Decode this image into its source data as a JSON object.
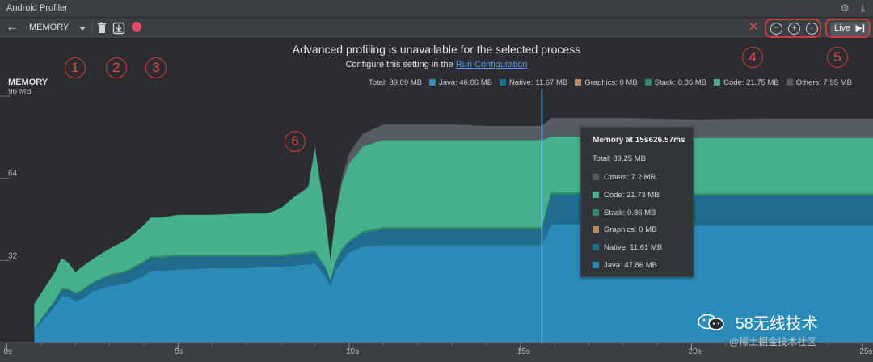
{
  "window": {
    "title": "Android Profiler"
  },
  "toolbar": {
    "profiler_select": "MEMORY",
    "live_label": "Live"
  },
  "banner": {
    "message": "Advanced profiling is unavailable for the selected process",
    "sub_prefix": "Configure this setting in the",
    "sub_link": "Run Configuration"
  },
  "callouts": [
    "1",
    "2",
    "3",
    "4",
    "5",
    "6"
  ],
  "stage": {
    "label": "MEMORY"
  },
  "legend": [
    {
      "text": "Total: 89.09 MB",
      "color": ""
    },
    {
      "text": "Java: 46.86 MB",
      "color": "#2a8ab8"
    },
    {
      "text": "Native: 11.67 MB",
      "color": "#1f6c8f"
    },
    {
      "text": "Graphics: 0 MB",
      "color": "#b58b6b"
    },
    {
      "text": "Stack: 0.86 MB",
      "color": "#2f8a6b"
    },
    {
      "text": "Code: 21.75 MB",
      "color": "#45b08c"
    },
    {
      "text": "Others: 7.95 MB",
      "color": "#565c63"
    }
  ],
  "tooltip": {
    "title": "Memory at 15s626.57ms",
    "total": "Total: 89.25 MB",
    "rows": [
      {
        "text": "Others: 7.2 MB",
        "color": "#565c63"
      },
      {
        "text": "Code: 21.73 MB",
        "color": "#45b08c"
      },
      {
        "text": "Stack: 0.86 MB",
        "color": "#2f8a6b"
      },
      {
        "text": "Graphics: 0 MB",
        "color": "#b58b6b"
      },
      {
        "text": "Native: 11.61 MB",
        "color": "#1f6c8f"
      },
      {
        "text": "Java: 47.86 MB",
        "color": "#2a8ab8"
      }
    ]
  },
  "watermark": {
    "text": "58无线技术",
    "sub": "@稀土掘金技术社区"
  },
  "chart_data": {
    "type": "area",
    "stacked": true,
    "y_ticks": [
      {
        "value": 96,
        "label": "96 MB"
      },
      {
        "value": 64,
        "label": "64"
      },
      {
        "value": 32,
        "label": "32"
      }
    ],
    "ylim": [
      0,
      96
    ],
    "x_ticks": [
      {
        "value": 0,
        "label": "0s"
      },
      {
        "value": 5,
        "label": "5s"
      },
      {
        "value": 10,
        "label": "10s"
      },
      {
        "value": 15,
        "label": "15s"
      },
      {
        "value": 20,
        "label": "20s"
      },
      {
        "value": 25,
        "label": "25s"
      }
    ],
    "xlim": [
      -0.2,
      25.3
    ],
    "cursor_x": 15.63,
    "x": [
      0.8,
      1.0,
      1.4,
      1.6,
      1.8,
      2.0,
      2.2,
      2.5,
      3.0,
      3.5,
      4.0,
      4.2,
      4.5,
      5.0,
      6.0,
      7.0,
      7.6,
      8.0,
      8.4,
      8.8,
      9.0,
      9.3,
      9.45,
      9.6,
      9.8,
      10.0,
      10.4,
      11.0,
      12.0,
      13.0,
      14.0,
      15.0,
      15.63,
      15.9,
      16.5,
      18.0,
      20.0,
      22.0,
      24.0,
      25.3
    ],
    "series": [
      {
        "name": "Java",
        "color": "#2a8ab8",
        "values": [
          5,
          8,
          14,
          18,
          18,
          16,
          17,
          20,
          22,
          23,
          26,
          28,
          28,
          28.5,
          29,
          29,
          29.5,
          29.5,
          30,
          30.5,
          31,
          26,
          22,
          28,
          32,
          35,
          37.5,
          38,
          38,
          38,
          38,
          38,
          38,
          46,
          46,
          46,
          45.5,
          45.5,
          45.5,
          45.5
        ]
      },
      {
        "name": "Native",
        "color": "#1f6c8f",
        "values": [
          0,
          1,
          2,
          2.5,
          2.5,
          3,
          3,
          3,
          4,
          4.5,
          5,
          5,
          5,
          5,
          4.5,
          4.5,
          4,
          4,
          4,
          4,
          4,
          3,
          2,
          3,
          4,
          4,
          5,
          6,
          6,
          6,
          6,
          6,
          6,
          11.7,
          11.7,
          11.7,
          11.7,
          11.7,
          11.7,
          11.7
        ]
      },
      {
        "name": "Stack",
        "color": "#2f8a6b",
        "values": [
          0,
          0.2,
          0.4,
          0.5,
          0.5,
          0.5,
          0.5,
          0.5,
          0.6,
          0.6,
          0.7,
          0.7,
          0.7,
          0.8,
          0.8,
          0.8,
          0.8,
          0.8,
          0.8,
          0.8,
          0.8,
          0.5,
          0.3,
          0.5,
          0.8,
          0.8,
          0.9,
          0.9,
          0.9,
          0.9,
          0.9,
          0.9,
          0.9,
          0.86,
          0.86,
          0.86,
          0.86,
          0.86,
          0.86,
          0.86
        ]
      },
      {
        "name": "Code",
        "color": "#45b08c",
        "values": [
          10,
          10,
          11,
          12,
          10,
          8,
          9,
          9,
          10,
          12,
          14,
          15,
          15,
          15.5,
          15.5,
          16,
          16,
          18,
          22,
          25,
          40,
          20,
          8,
          18,
          26,
          30,
          33,
          34,
          34,
          34,
          34,
          34,
          34,
          21.7,
          21.7,
          21.7,
          21.7,
          21.7,
          21.7,
          21.7
        ]
      },
      {
        "name": "Others",
        "color": "#565c63",
        "values": [
          0,
          0,
          0,
          0,
          0,
          0,
          0,
          0,
          0,
          0,
          0,
          0,
          0,
          0,
          0,
          0,
          0,
          0,
          0,
          0.5,
          1,
          0.5,
          0,
          1,
          2,
          4,
          5,
          6,
          6,
          6,
          5.5,
          5.5,
          5.5,
          7.2,
          7.2,
          7.2,
          7.2,
          7.5,
          7.5,
          7.5
        ]
      }
    ]
  }
}
